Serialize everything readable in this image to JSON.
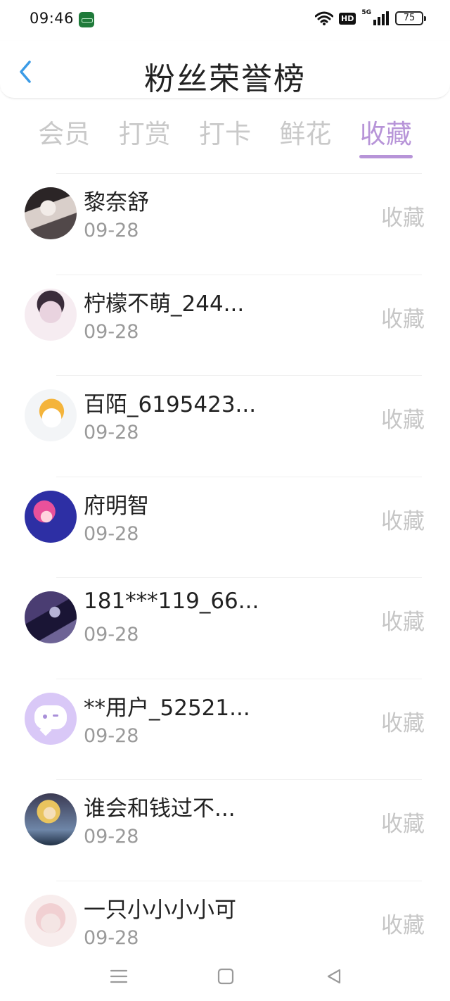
{
  "status_bar": {
    "time": "09:46",
    "app_icon": "oppo-app-icon",
    "hd_label": "HD",
    "signal_label": "5G",
    "battery": "75"
  },
  "header": {
    "back_icon": "chevron-left-icon",
    "title": "粉丝荣誉榜"
  },
  "tabs": [
    {
      "label": "会员",
      "active": false
    },
    {
      "label": "打赏",
      "active": false
    },
    {
      "label": "打卡",
      "active": false
    },
    {
      "label": "鲜花",
      "active": false
    },
    {
      "label": "收藏",
      "active": true
    }
  ],
  "colors": {
    "accent": "#b794d8",
    "inactive_tab": "#c9c9c9",
    "date": "#9a9a9a",
    "action": "#c6c6c6"
  },
  "list": [
    {
      "name": "黎奈舒",
      "date": "09-28",
      "action": "收藏"
    },
    {
      "name": "柠檬不萌_244...",
      "date": "09-28",
      "action": "收藏"
    },
    {
      "name": "百陌_6195423...",
      "date": "09-28",
      "action": "收藏"
    },
    {
      "name": "府明智",
      "date": "09-28",
      "action": "收藏"
    },
    {
      "name": "181***119_66...",
      "date": "09-28",
      "action": "收藏"
    },
    {
      "name": "**用户_52521...",
      "date": "09-28",
      "action": "收藏"
    },
    {
      "name": "谁会和钱过不...",
      "date": "09-28",
      "action": "收藏"
    },
    {
      "name": "一只小小小小可",
      "date": "09-28",
      "action": "收藏"
    }
  ],
  "nav_bar": {
    "menu_icon": "menu-icon",
    "home_icon": "home-square-icon",
    "back_icon": "back-triangle-icon"
  }
}
